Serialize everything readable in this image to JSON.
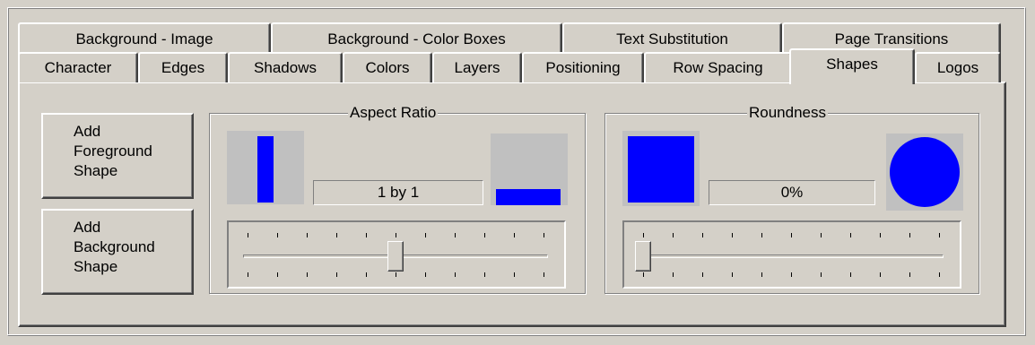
{
  "tabs_back_row": [
    {
      "label": "Background - Image"
    },
    {
      "label": "Background - Color Boxes"
    },
    {
      "label": "Text Substitution"
    },
    {
      "label": "Page Transitions"
    }
  ],
  "tabs_front_row": [
    {
      "label": "Character"
    },
    {
      "label": "Edges"
    },
    {
      "label": "Shadows"
    },
    {
      "label": "Colors"
    },
    {
      "label": "Layers"
    },
    {
      "label": "Positioning"
    },
    {
      "label": "Row Spacing"
    },
    {
      "label": "Shapes",
      "active": true
    },
    {
      "label": "Logos"
    }
  ],
  "buttons": {
    "add_foreground": "Add\nForeground\nShape",
    "add_background": "Add\nBackground\nShape"
  },
  "aspect_ratio": {
    "title": "Aspect Ratio",
    "value_text": "1 by 1",
    "slider_position": 0.5,
    "tick_count": 11
  },
  "roundness": {
    "title": "Roundness",
    "value_text": "0%",
    "slider_position": 0.0,
    "tick_count": 11
  },
  "colors": {
    "face": "#d4d0c8",
    "shape_fill": "#0000ff",
    "preview_bg": "#c0c0c0"
  }
}
